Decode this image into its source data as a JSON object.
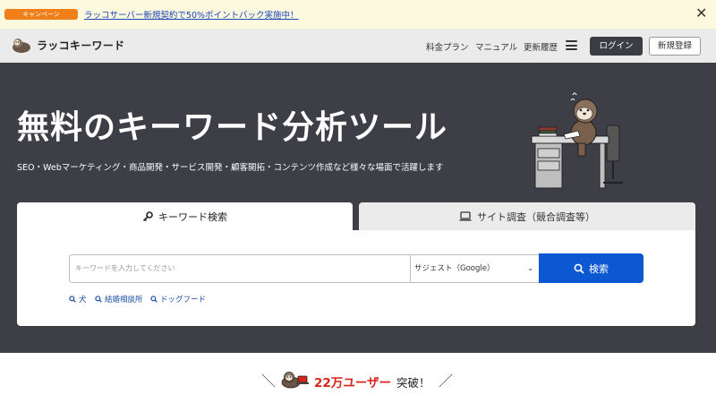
{
  "campaign": {
    "badge": "キャンペーン",
    "link_text": "ラッコサーバー新規契約で50%ポイントバック実施中！",
    "close_icon": "close-icon"
  },
  "header": {
    "logo_text": "ラッコキーワード",
    "nav": [
      {
        "label": "料金プラン"
      },
      {
        "label": "マニュアル"
      },
      {
        "label": "更新履歴"
      }
    ],
    "menu_icon": "hamburger-icon",
    "login_label": "ログイン",
    "signup_label": "新規登録"
  },
  "hero": {
    "title": "無料のキーワード分析ツール",
    "subtitle": "SEO・Webマーケティング・商品開発・サービス開発・顧客開拓・コンテンツ作成など様々な場面で活躍します"
  },
  "tabs": [
    {
      "label": "キーワード検索",
      "icon": "key-icon",
      "active": true
    },
    {
      "label": "サイト調査（競合調査等）",
      "icon": "laptop-icon",
      "active": false
    }
  ],
  "search": {
    "placeholder": "キーワードを入力してください",
    "mode_selected": "サジェスト（Google）",
    "button_label": "検索",
    "suggestions": [
      "犬",
      "結婚相談所",
      "ドッグフード"
    ]
  },
  "users_banner": {
    "count": "22万ユーザー",
    "suffix": "突破！"
  },
  "colors": {
    "campaign_bg": "#fcf9df",
    "badge": "#f07f1a",
    "hero_bg": "#3d3e46",
    "primary": "#0c58d3",
    "accent_red": "#d6241a"
  }
}
